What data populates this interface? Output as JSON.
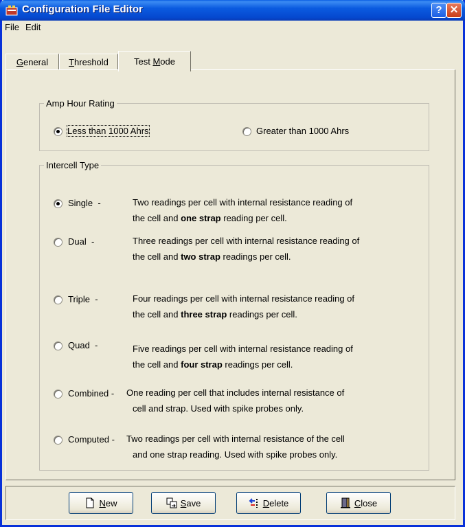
{
  "window": {
    "title": "Configuration File Editor"
  },
  "menu": {
    "file": "File",
    "edit": "Edit"
  },
  "tabs": [
    {
      "pre": "",
      "u": "G",
      "post": "eneral"
    },
    {
      "pre": "",
      "u": "T",
      "post": "hreshold"
    },
    {
      "pre": "Test ",
      "u": "M",
      "post": "ode"
    }
  ],
  "amp": {
    "legend": "Amp Hour Rating",
    "less": {
      "label": "Less than 1000 Ahrs",
      "checked": true
    },
    "greater": {
      "label": "Greater than 1000 Ahrs",
      "checked": false
    }
  },
  "intercell": {
    "legend": "Intercell Type",
    "options": [
      {
        "label": "Single",
        "dash": "-",
        "checked": true,
        "line1": "Two readings per cell with internal resistance reading of",
        "line2_pre": "the cell and ",
        "line2_bold": "one strap",
        "line2_post": " reading per cell."
      },
      {
        "label": "Dual",
        "dash": "-",
        "checked": false,
        "line1": "Three readings per cell with internal resistance reading of",
        "line2_pre": "the cell and ",
        "line2_bold": "two strap",
        "line2_post": " readings per cell."
      },
      {
        "label": "Triple",
        "dash": "-",
        "checked": false,
        "line1": "Four readings per cell with internal resistance reading of",
        "line2_pre": "the cell and ",
        "line2_bold": "three strap",
        "line2_post": " readings per cell."
      },
      {
        "label": "Quad",
        "dash": "-",
        "checked": false,
        "line1": "Five readings per cell with internal resistance reading of",
        "line2_pre": "the cell and ",
        "line2_bold": "four strap",
        "line2_post": " readings per cell."
      },
      {
        "label": "Combined",
        "dash": "-",
        "checked": false,
        "line1": "One reading per cell that includes internal resistance of",
        "line2_pre": "cell and strap. Used with spike probes only.",
        "line2_bold": "",
        "line2_post": ""
      },
      {
        "label": "Computed",
        "dash": "-",
        "checked": false,
        "line1": "Two readings per cell with internal resistance of the cell",
        "line2_pre": "and one strap reading. Used with spike probes only.",
        "line2_bold": "",
        "line2_post": ""
      }
    ]
  },
  "buttons": {
    "new": {
      "u": "N",
      "rest": "ew"
    },
    "save": {
      "u": "S",
      "rest": "ave"
    },
    "delete": {
      "u": "D",
      "rest": "elete"
    },
    "close": {
      "u": "C",
      "rest": "lose"
    }
  }
}
